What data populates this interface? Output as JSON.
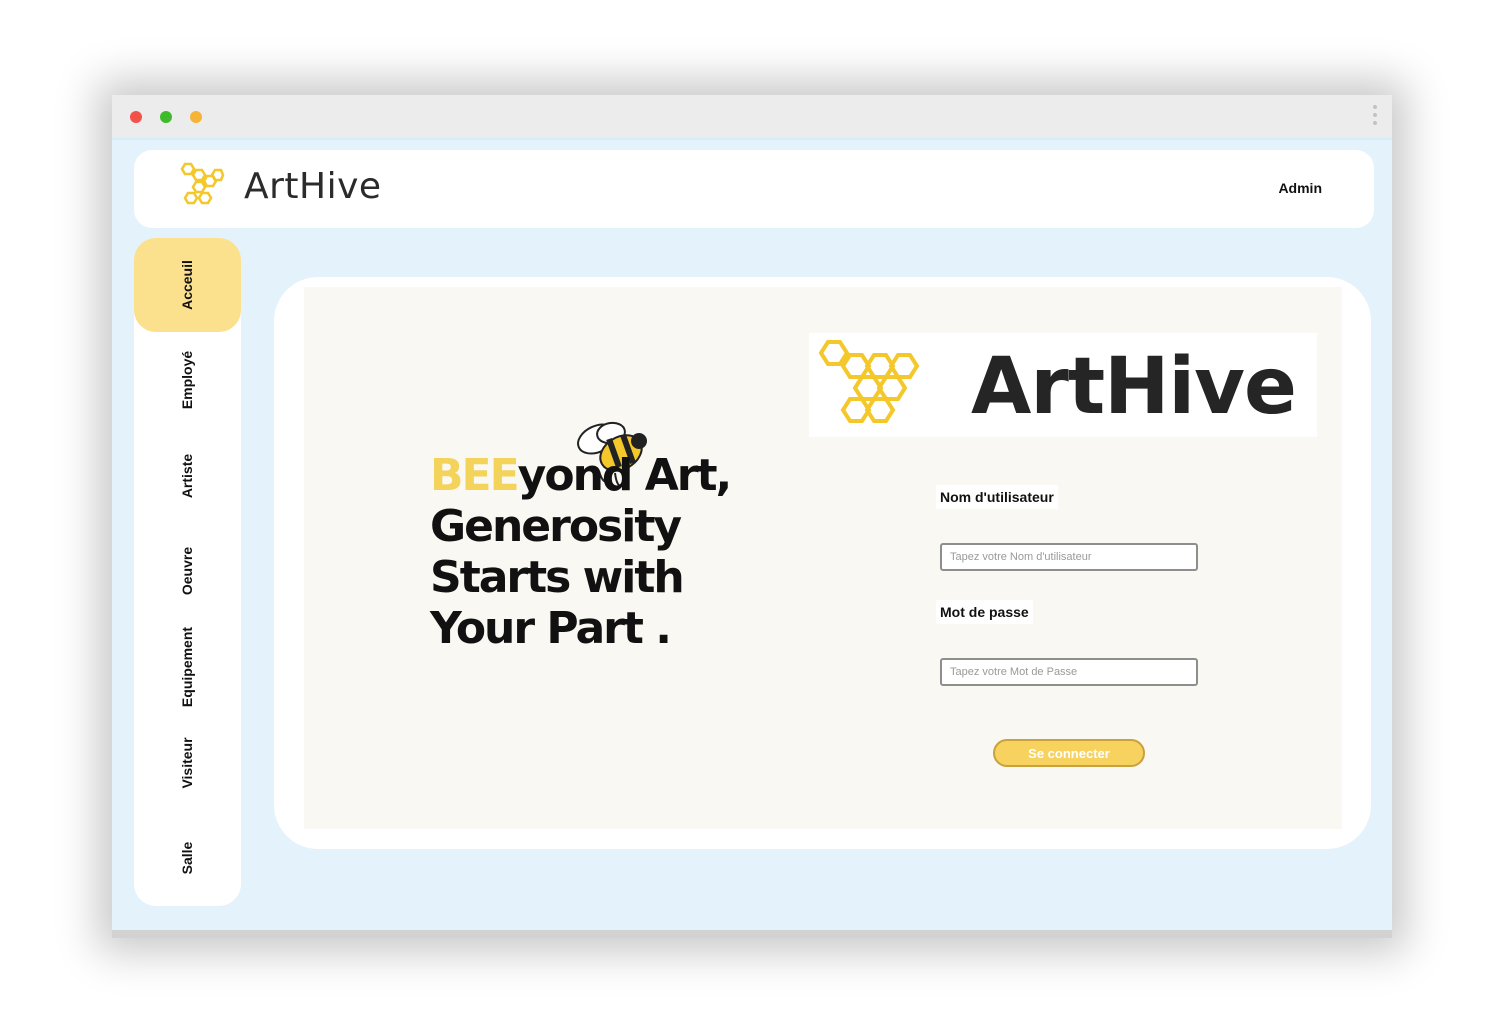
{
  "window": {
    "controls": [
      "close",
      "maximize",
      "minimize"
    ],
    "menu_icon": "kebab-menu-icon"
  },
  "header": {
    "logo_icon": "honeycomb-icon",
    "brand": "ArtHive",
    "user": "Admin"
  },
  "sidebar": {
    "items": [
      {
        "label": "Acceuil",
        "active": true
      },
      {
        "label": "Employé",
        "active": false
      },
      {
        "label": "Artiste",
        "active": false
      },
      {
        "label": "Oeuvre",
        "active": false
      },
      {
        "label": "Equipement",
        "active": false
      },
      {
        "label": "Visiteur",
        "active": false
      },
      {
        "label": "Salle",
        "active": false
      }
    ]
  },
  "hero": {
    "tagline_highlight": "BEE",
    "tagline_line1_rest": "yond Art,",
    "tagline_line2": "Generosity",
    "tagline_line3": "Starts with",
    "tagline_line4": "Your Part .",
    "illustration": "bee-icon"
  },
  "login": {
    "brand": "ArtHive",
    "username_label": "Nom d'utilisateur",
    "username_placeholder": "Tapez votre Nom d'utilisateur",
    "username_value": "",
    "password_label": "Mot de passe",
    "password_placeholder": "Tapez votre Mot de Passe",
    "password_value": "",
    "submit_label": "Se connecter"
  },
  "colors": {
    "accent": "#f7d25f",
    "active_nav": "#fbe08e",
    "background": "#e3f2fb",
    "honeycomb": "#f4c82a"
  }
}
